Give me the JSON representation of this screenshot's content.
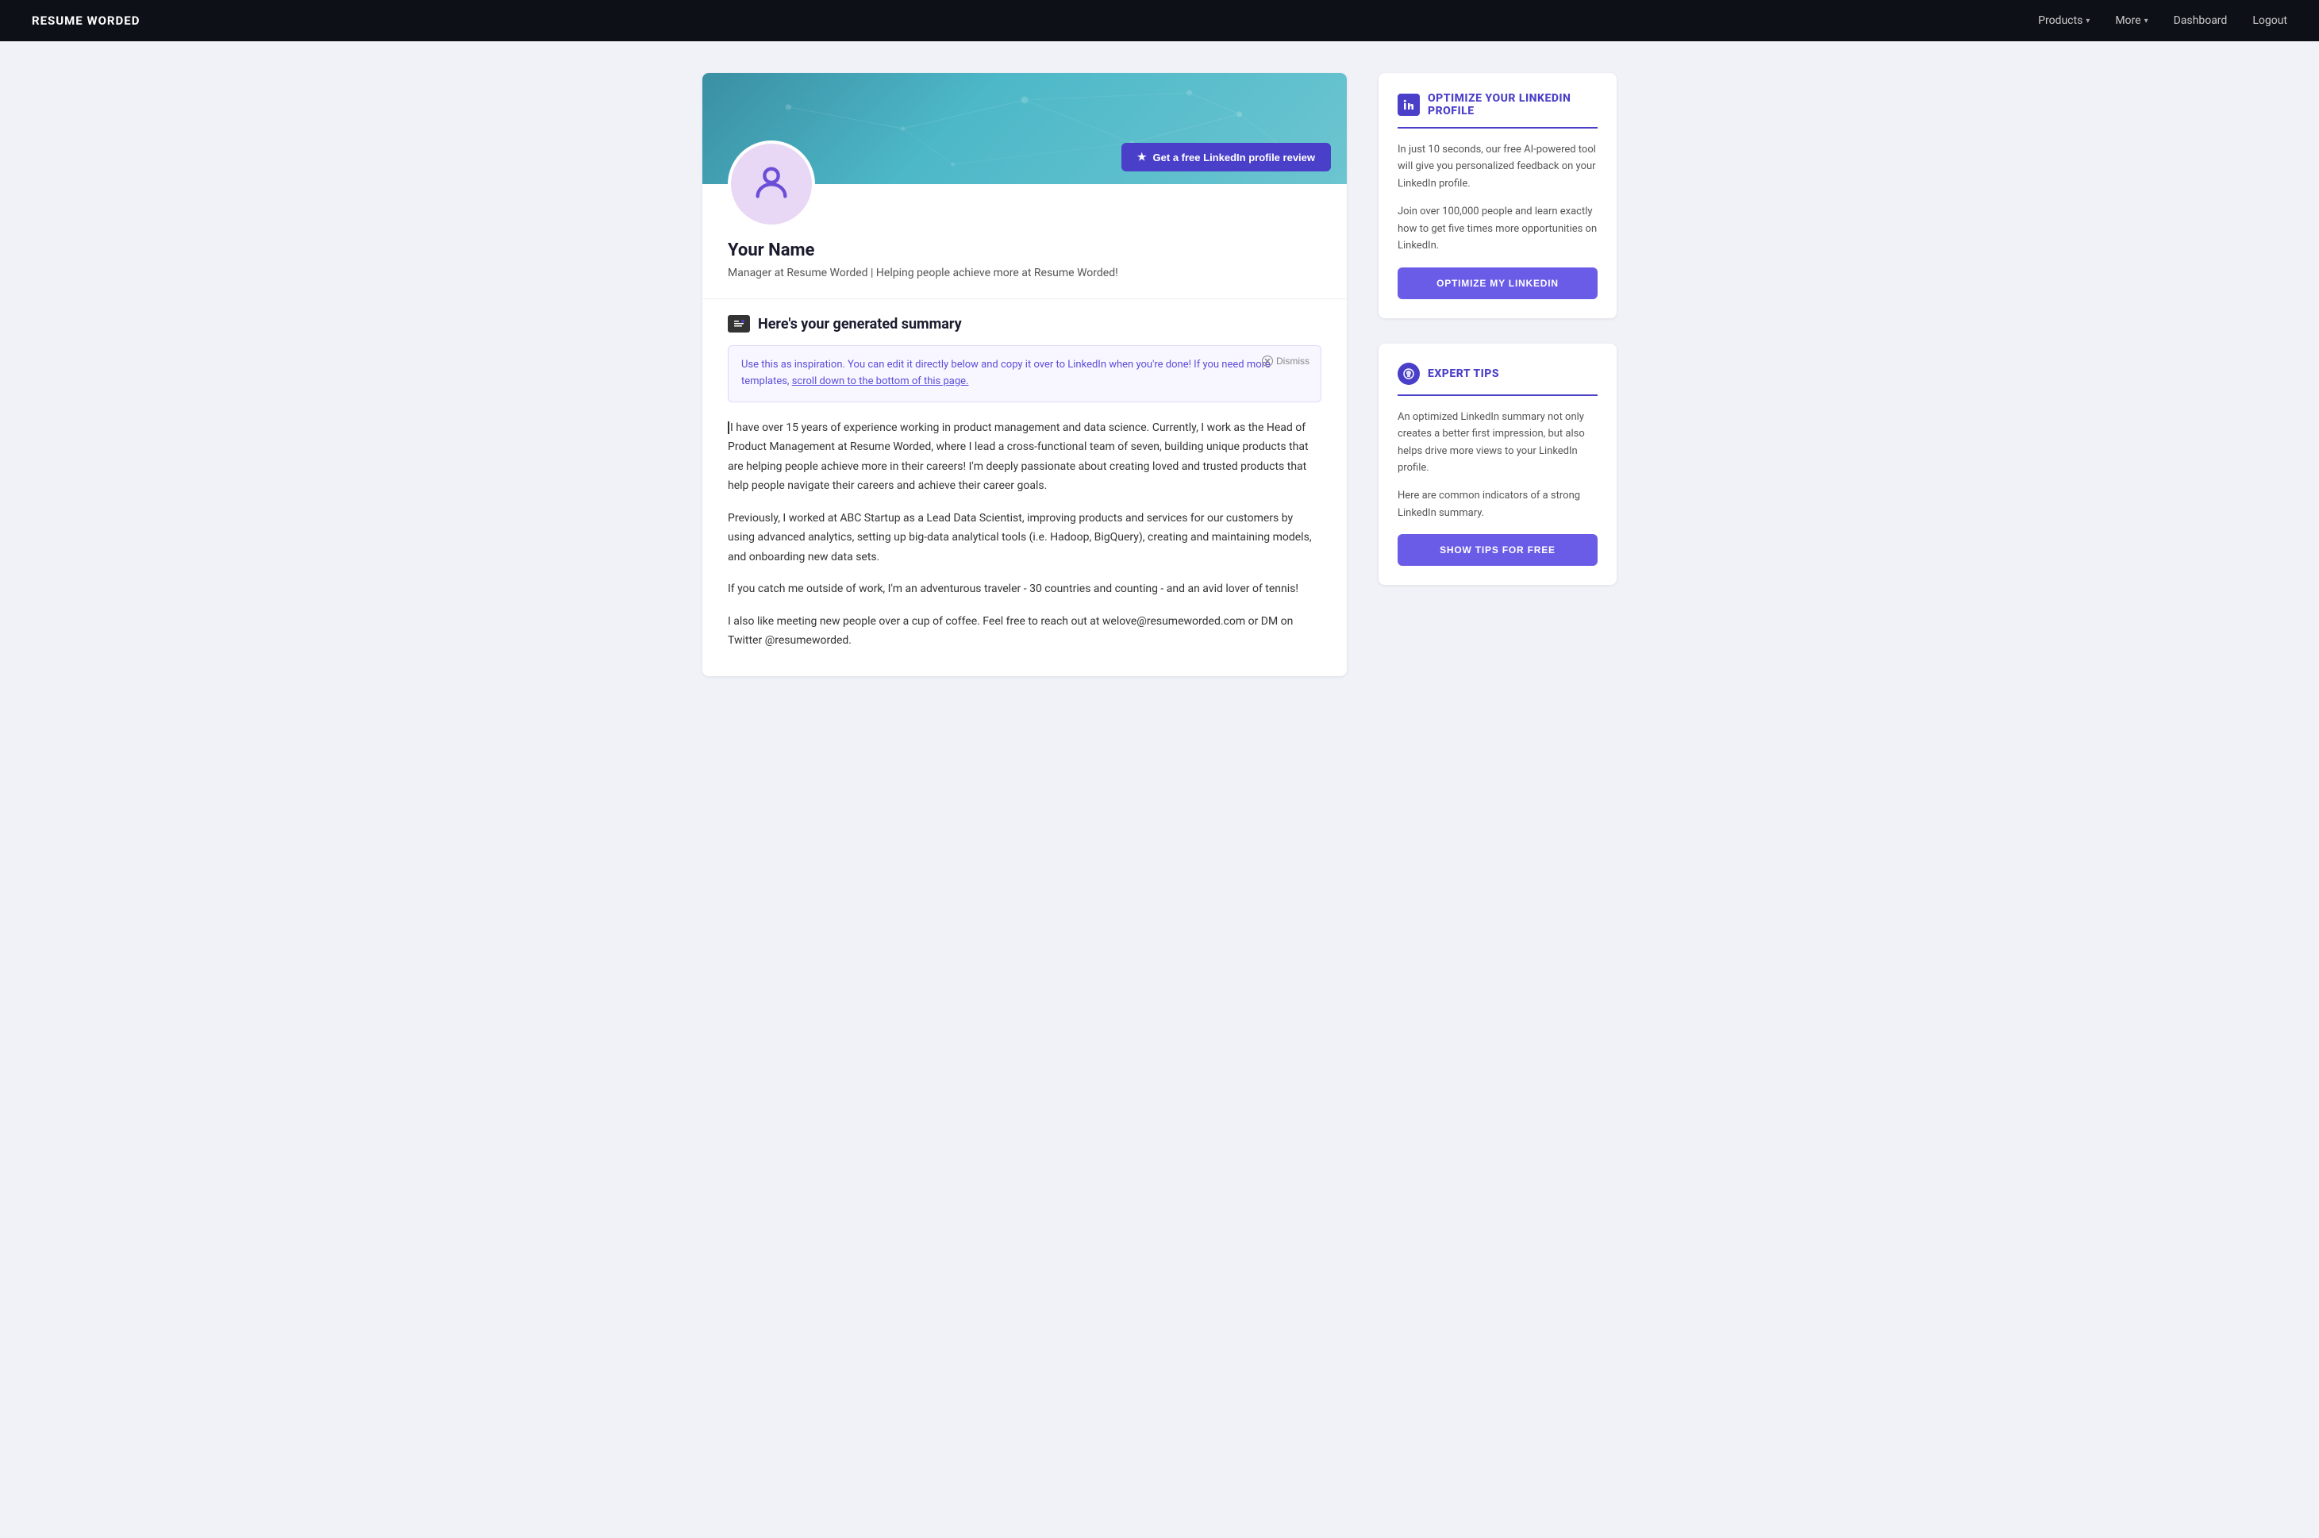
{
  "nav": {
    "logo": "RESUME WORDED",
    "products_label": "Products",
    "more_label": "More",
    "dashboard_label": "Dashboard",
    "logout_label": "Logout"
  },
  "profile": {
    "name": "Your Name",
    "headline": "Manager at Resume Worded | Helping people achieve more at Resume Worded!",
    "review_btn": "Get a free LinkedIn profile review"
  },
  "summary": {
    "section_title": "Here's your generated summary",
    "tip_text": "Use this as inspiration. You can edit it directly below and copy it over to LinkedIn when you're done! If you need more templates, scroll down to the bottom of this page.",
    "dismiss_label": "Dismiss",
    "paragraphs": [
      "I have over 15 years of experience working in product management and data science. Currently, I work as the Head of Product Management at Resume Worded, where I lead a cross-functional team of seven, building unique products that are helping people achieve more in their careers! I'm deeply passionate about creating loved and trusted products that help people navigate their careers and achieve their career goals.",
      "Previously, I worked at ABC Startup as a Lead Data Scientist, improving products and services for our customers by using advanced analytics, setting up big-data analytical tools (i.e. Hadoop, BigQuery), creating and maintaining models, and onboarding new data sets.",
      "If you catch me outside of work, I'm an adventurous traveler - 30 countries and counting - and an avid lover of tennis!",
      "I also like meeting new people over a cup of coffee. Feel free to reach out at welove@resumeworded.com or DM on Twitter @resumeworded."
    ]
  },
  "optimize_widget": {
    "title": "OPTIMIZE YOUR LINKEDIN PROFILE",
    "desc1": "In just 10 seconds, our free AI-powered tool will give you personalized feedback on your LinkedIn profile.",
    "desc2": "Join over 100,000 people and learn exactly how to get five times more opportunities on LinkedIn.",
    "btn_label": "OPTIMIZE MY LINKEDIN"
  },
  "tips_widget": {
    "title": "EXPERT TIPS",
    "desc1": "An optimized LinkedIn summary not only creates a better first impression, but also helps drive more views to your LinkedIn profile.",
    "desc2": "Here are common indicators of a strong LinkedIn summary.",
    "btn_label": "SHOW TIPS FOR FREE"
  }
}
